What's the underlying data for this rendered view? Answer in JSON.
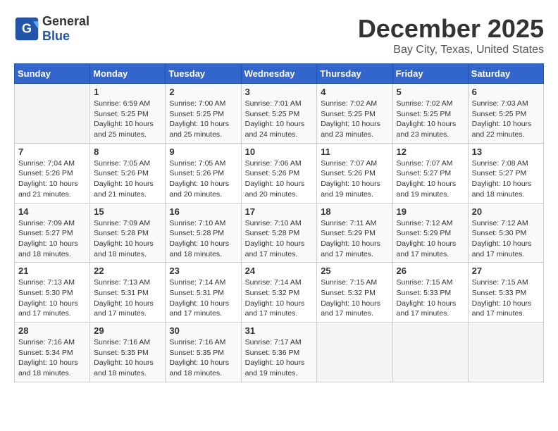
{
  "header": {
    "logo_general": "General",
    "logo_blue": "Blue",
    "month_title": "December 2025",
    "location": "Bay City, Texas, United States"
  },
  "days_of_week": [
    "Sunday",
    "Monday",
    "Tuesday",
    "Wednesday",
    "Thursday",
    "Friday",
    "Saturday"
  ],
  "weeks": [
    [
      {
        "day": "",
        "sunrise": "",
        "sunset": "",
        "daylight": ""
      },
      {
        "day": "1",
        "sunrise": "Sunrise: 6:59 AM",
        "sunset": "Sunset: 5:25 PM",
        "daylight": "Daylight: 10 hours and 25 minutes."
      },
      {
        "day": "2",
        "sunrise": "Sunrise: 7:00 AM",
        "sunset": "Sunset: 5:25 PM",
        "daylight": "Daylight: 10 hours and 25 minutes."
      },
      {
        "day": "3",
        "sunrise": "Sunrise: 7:01 AM",
        "sunset": "Sunset: 5:25 PM",
        "daylight": "Daylight: 10 hours and 24 minutes."
      },
      {
        "day": "4",
        "sunrise": "Sunrise: 7:02 AM",
        "sunset": "Sunset: 5:25 PM",
        "daylight": "Daylight: 10 hours and 23 minutes."
      },
      {
        "day": "5",
        "sunrise": "Sunrise: 7:02 AM",
        "sunset": "Sunset: 5:25 PM",
        "daylight": "Daylight: 10 hours and 23 minutes."
      },
      {
        "day": "6",
        "sunrise": "Sunrise: 7:03 AM",
        "sunset": "Sunset: 5:25 PM",
        "daylight": "Daylight: 10 hours and 22 minutes."
      }
    ],
    [
      {
        "day": "7",
        "sunrise": "Sunrise: 7:04 AM",
        "sunset": "Sunset: 5:26 PM",
        "daylight": "Daylight: 10 hours and 21 minutes."
      },
      {
        "day": "8",
        "sunrise": "Sunrise: 7:05 AM",
        "sunset": "Sunset: 5:26 PM",
        "daylight": "Daylight: 10 hours and 21 minutes."
      },
      {
        "day": "9",
        "sunrise": "Sunrise: 7:05 AM",
        "sunset": "Sunset: 5:26 PM",
        "daylight": "Daylight: 10 hours and 20 minutes."
      },
      {
        "day": "10",
        "sunrise": "Sunrise: 7:06 AM",
        "sunset": "Sunset: 5:26 PM",
        "daylight": "Daylight: 10 hours and 20 minutes."
      },
      {
        "day": "11",
        "sunrise": "Sunrise: 7:07 AM",
        "sunset": "Sunset: 5:26 PM",
        "daylight": "Daylight: 10 hours and 19 minutes."
      },
      {
        "day": "12",
        "sunrise": "Sunrise: 7:07 AM",
        "sunset": "Sunset: 5:27 PM",
        "daylight": "Daylight: 10 hours and 19 minutes."
      },
      {
        "day": "13",
        "sunrise": "Sunrise: 7:08 AM",
        "sunset": "Sunset: 5:27 PM",
        "daylight": "Daylight: 10 hours and 18 minutes."
      }
    ],
    [
      {
        "day": "14",
        "sunrise": "Sunrise: 7:09 AM",
        "sunset": "Sunset: 5:27 PM",
        "daylight": "Daylight: 10 hours and 18 minutes."
      },
      {
        "day": "15",
        "sunrise": "Sunrise: 7:09 AM",
        "sunset": "Sunset: 5:28 PM",
        "daylight": "Daylight: 10 hours and 18 minutes."
      },
      {
        "day": "16",
        "sunrise": "Sunrise: 7:10 AM",
        "sunset": "Sunset: 5:28 PM",
        "daylight": "Daylight: 10 hours and 18 minutes."
      },
      {
        "day": "17",
        "sunrise": "Sunrise: 7:10 AM",
        "sunset": "Sunset: 5:28 PM",
        "daylight": "Daylight: 10 hours and 17 minutes."
      },
      {
        "day": "18",
        "sunrise": "Sunrise: 7:11 AM",
        "sunset": "Sunset: 5:29 PM",
        "daylight": "Daylight: 10 hours and 17 minutes."
      },
      {
        "day": "19",
        "sunrise": "Sunrise: 7:12 AM",
        "sunset": "Sunset: 5:29 PM",
        "daylight": "Daylight: 10 hours and 17 minutes."
      },
      {
        "day": "20",
        "sunrise": "Sunrise: 7:12 AM",
        "sunset": "Sunset: 5:30 PM",
        "daylight": "Daylight: 10 hours and 17 minutes."
      }
    ],
    [
      {
        "day": "21",
        "sunrise": "Sunrise: 7:13 AM",
        "sunset": "Sunset: 5:30 PM",
        "daylight": "Daylight: 10 hours and 17 minutes."
      },
      {
        "day": "22",
        "sunrise": "Sunrise: 7:13 AM",
        "sunset": "Sunset: 5:31 PM",
        "daylight": "Daylight: 10 hours and 17 minutes."
      },
      {
        "day": "23",
        "sunrise": "Sunrise: 7:14 AM",
        "sunset": "Sunset: 5:31 PM",
        "daylight": "Daylight: 10 hours and 17 minutes."
      },
      {
        "day": "24",
        "sunrise": "Sunrise: 7:14 AM",
        "sunset": "Sunset: 5:32 PM",
        "daylight": "Daylight: 10 hours and 17 minutes."
      },
      {
        "day": "25",
        "sunrise": "Sunrise: 7:15 AM",
        "sunset": "Sunset: 5:32 PM",
        "daylight": "Daylight: 10 hours and 17 minutes."
      },
      {
        "day": "26",
        "sunrise": "Sunrise: 7:15 AM",
        "sunset": "Sunset: 5:33 PM",
        "daylight": "Daylight: 10 hours and 17 minutes."
      },
      {
        "day": "27",
        "sunrise": "Sunrise: 7:15 AM",
        "sunset": "Sunset: 5:33 PM",
        "daylight": "Daylight: 10 hours and 17 minutes."
      }
    ],
    [
      {
        "day": "28",
        "sunrise": "Sunrise: 7:16 AM",
        "sunset": "Sunset: 5:34 PM",
        "daylight": "Daylight: 10 hours and 18 minutes."
      },
      {
        "day": "29",
        "sunrise": "Sunrise: 7:16 AM",
        "sunset": "Sunset: 5:35 PM",
        "daylight": "Daylight: 10 hours and 18 minutes."
      },
      {
        "day": "30",
        "sunrise": "Sunrise: 7:16 AM",
        "sunset": "Sunset: 5:35 PM",
        "daylight": "Daylight: 10 hours and 18 minutes."
      },
      {
        "day": "31",
        "sunrise": "Sunrise: 7:17 AM",
        "sunset": "Sunset: 5:36 PM",
        "daylight": "Daylight: 10 hours and 19 minutes."
      },
      {
        "day": "",
        "sunrise": "",
        "sunset": "",
        "daylight": ""
      },
      {
        "day": "",
        "sunrise": "",
        "sunset": "",
        "daylight": ""
      },
      {
        "day": "",
        "sunrise": "",
        "sunset": "",
        "daylight": ""
      }
    ]
  ]
}
